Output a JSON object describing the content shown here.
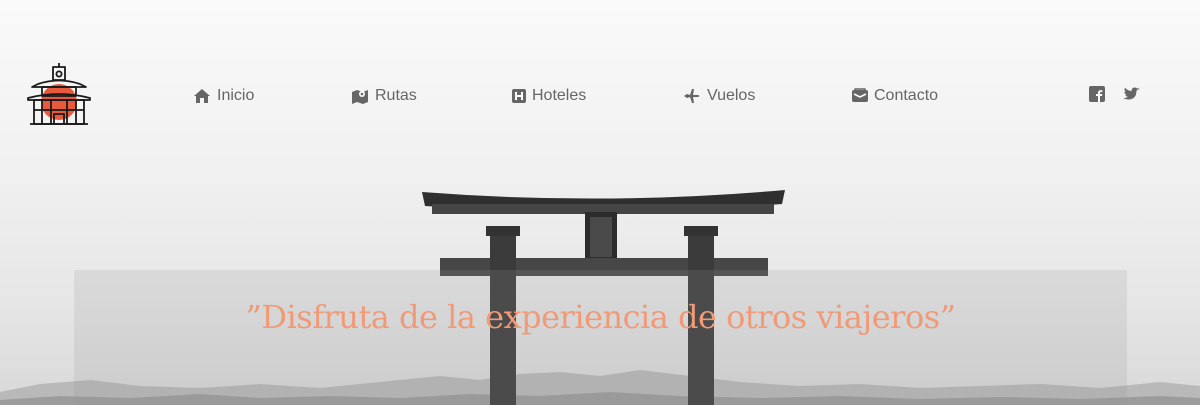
{
  "nav": {
    "items": [
      {
        "label": "Inicio",
        "icon": "home-icon"
      },
      {
        "label": "Rutas",
        "icon": "map-icon"
      },
      {
        "label": "Hoteles",
        "icon": "hotel-icon"
      },
      {
        "label": "Vuelos",
        "icon": "plane-icon"
      },
      {
        "label": "Contacto",
        "icon": "envelope-icon"
      }
    ]
  },
  "social": [
    {
      "icon": "facebook-icon"
    },
    {
      "icon": "twitter-icon"
    }
  ],
  "hero": {
    "quote": "”Disfruta de la experiencia de otros viajeros”"
  },
  "colors": {
    "accent": "#f09a78",
    "logo_sun": "#e85a3c",
    "nav_text": "#666666"
  }
}
